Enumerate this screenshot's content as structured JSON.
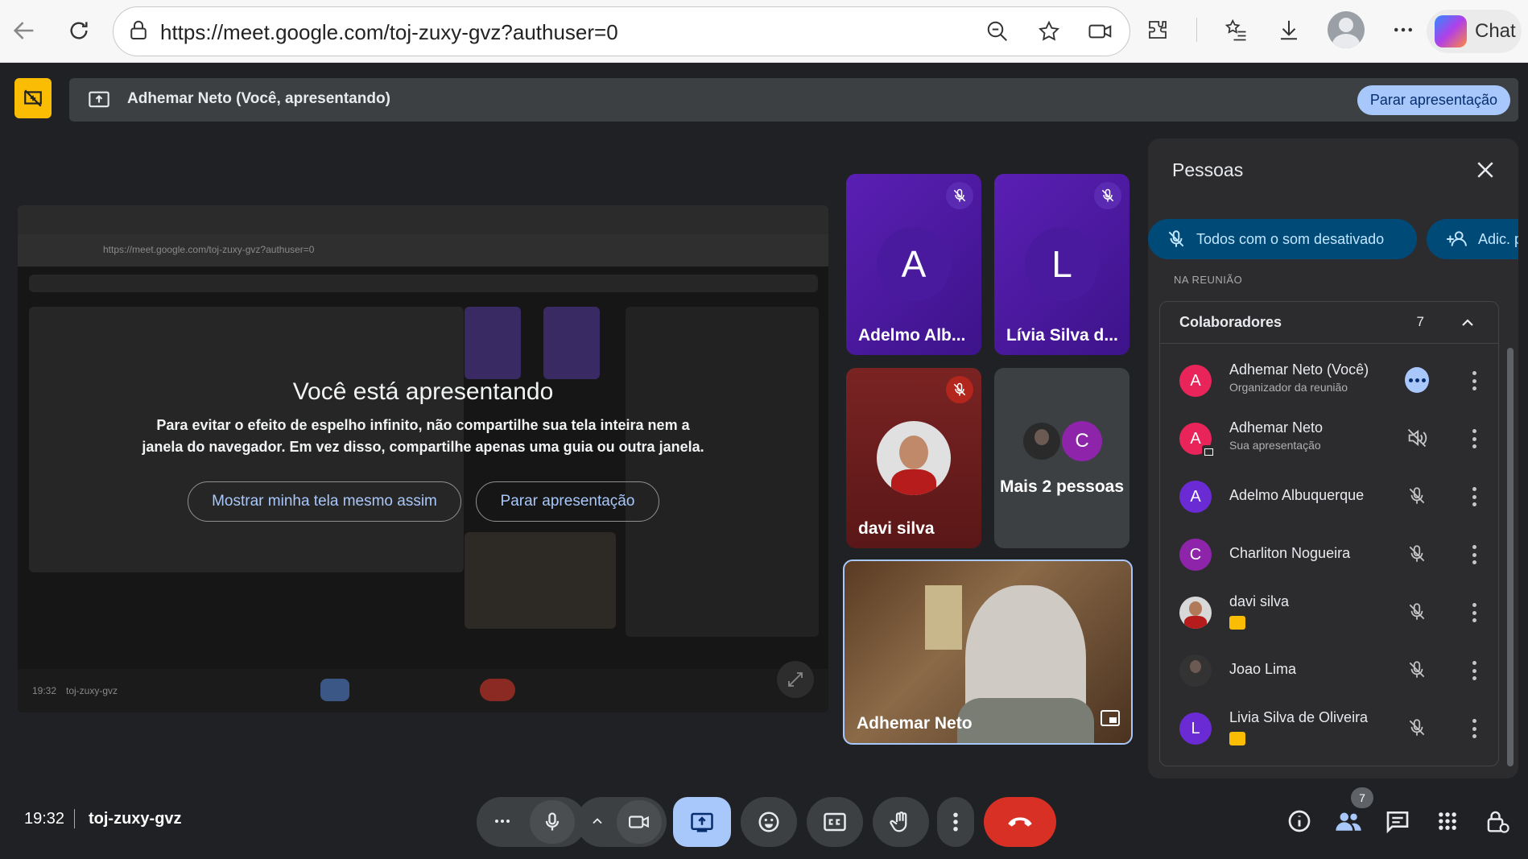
{
  "browser": {
    "url": "https://meet.google.com/toj-zuxy-gvz?authuser=0",
    "chat_label": "Chat"
  },
  "presenting_bar": {
    "text": "Adhemar Neto (Você, apresentando)",
    "stop_label": "Parar apresentação"
  },
  "shared_screen": {
    "mini_url": "https://meet.google.com/toj-zuxy-gvz?authuser=0",
    "mini_time": "19:32",
    "mini_code": "toj-zuxy-gvz",
    "overlay_title": "Você está apresentando",
    "overlay_text": "Para evitar o efeito de espelho infinito, não compartilhe sua tela inteira nem a janela do navegador. Em vez disso, compartilhe apenas uma guia ou outra janela.",
    "show_anyway_label": "Mostrar minha tela mesmo assim",
    "stop_label": "Parar apresentação"
  },
  "tiles": [
    {
      "name": "Adelmo Alb...",
      "initial": "A",
      "muted": true
    },
    {
      "name": "Lívia Silva d...",
      "initial": "L",
      "muted": true
    },
    {
      "name": "davi silva",
      "muted": true
    },
    {
      "name": "Mais 2 pessoas",
      "initial": "C"
    },
    {
      "name": "Adhemar Neto"
    }
  ],
  "people_panel": {
    "title": "Pessoas",
    "mute_all_label": "Todos com o som desativado",
    "add_label": "Adic. p",
    "section_label": "NA REUNIÃO",
    "group_title": "Colaboradores",
    "group_count": "7",
    "participants": [
      {
        "name": "Adhemar Neto (Você)",
        "sub": "Organizador da reunião",
        "initial": "A",
        "color": "#e8245b",
        "status": "more"
      },
      {
        "name": "Adhemar Neto",
        "sub": "Sua apresentação",
        "initial": "A",
        "color": "#e8245b",
        "status": "audio-off"
      },
      {
        "name": "Adelmo Albuquerque",
        "sub": "",
        "initial": "A",
        "color": "#6b2bd4",
        "status": "mic-off"
      },
      {
        "name": "Charliton Nogueira",
        "sub": "",
        "initial": "C",
        "color": "#8e24aa",
        "status": "mic-off"
      },
      {
        "name": "davi silva",
        "sub": "",
        "initial": "",
        "color": "#777777",
        "status": "mic-off"
      },
      {
        "name": "Joao Lima",
        "sub": "",
        "initial": "",
        "color": "#444444",
        "status": "mic-off"
      },
      {
        "name": "Livia Silva de Oliveira",
        "sub": "",
        "initial": "L",
        "color": "#6b2bd4",
        "status": "mic-off"
      }
    ]
  },
  "bottom_bar": {
    "time": "19:32",
    "meeting_code": "toj-zuxy-gvz",
    "people_count": "7"
  },
  "colors": {
    "accent": "#a8c7fa",
    "end_call": "#d93025",
    "presenting_yellow": "#fbbc04"
  }
}
